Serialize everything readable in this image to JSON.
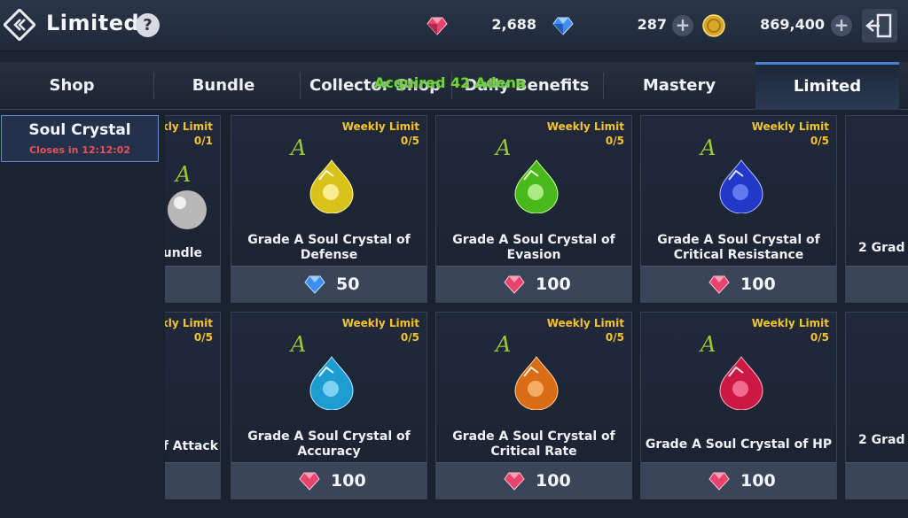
{
  "header": {
    "title": "Limited",
    "help_label": "?",
    "currencies": [
      {
        "icon": "red-gem-icon",
        "value": "2,688"
      },
      {
        "icon": "blue-diamond-icon",
        "value": "287"
      },
      {
        "icon": "gold-coin-icon",
        "value": "869,400"
      }
    ]
  },
  "tabs": [
    {
      "label": "Shop",
      "active": false
    },
    {
      "label": "Bundle",
      "active": false
    },
    {
      "label": "Collector Shop",
      "active": false
    },
    {
      "label": "Daily Benefits",
      "active": false
    },
    {
      "label": "Mastery",
      "active": false
    },
    {
      "label": "Limited",
      "active": true
    }
  ],
  "toast": "Acquired 42 Adena",
  "sidebar": {
    "items": [
      {
        "label": "Soul Crystal",
        "sub": "Closes in 12:12:02"
      }
    ]
  },
  "colors": {
    "accent": "#5d8cd6",
    "limit_text": "#f4c430",
    "timer_text": "#e8505b",
    "toast_text": "#6fd33b"
  },
  "cards": [
    {
      "limit_label": "Weekly Limit",
      "limit_count": "0/1",
      "name": "Bundle",
      "grade": "A",
      "gem_color": "#c8c8c8",
      "price_icon": "",
      "price": ""
    },
    {
      "limit_label": "Weekly Limit",
      "limit_count": "0/5",
      "name": "Grade A Soul Crystal of Defense",
      "grade": "A",
      "gem_color": "#e2cf1c",
      "price_icon": "blue-diamond-icon",
      "price": "50"
    },
    {
      "limit_label": "Weekly Limit",
      "limit_count": "0/5",
      "name": "Grade A Soul Crystal of Evasion",
      "grade": "A",
      "gem_color": "#4fc31a",
      "price_icon": "red-gem-icon",
      "price": "100"
    },
    {
      "limit_label": "Weekly Limit",
      "limit_count": "0/5",
      "name": "Grade A Soul Crystal of Critical Resistance",
      "grade": "A",
      "gem_color": "#2741d6",
      "price_icon": "red-gem-icon",
      "price": "100"
    },
    {
      "limit_label": "",
      "limit_count": "",
      "name": "2 Grad",
      "grade": "",
      "gem_color": "",
      "price_icon": "",
      "price": ""
    },
    {
      "limit_label": "Weekly Limit",
      "limit_count": "0/5",
      "name": "of Attack",
      "grade": "",
      "gem_color": "",
      "price_icon": "",
      "price": ""
    },
    {
      "limit_label": "Weekly Limit",
      "limit_count": "0/5",
      "name": "Grade A Soul Crystal of Accuracy",
      "grade": "A",
      "gem_color": "#1fa6d6",
      "price_icon": "red-gem-icon",
      "price": "100"
    },
    {
      "limit_label": "Weekly Limit",
      "limit_count": "0/5",
      "name": "Grade A Soul Crystal of Critical Rate",
      "grade": "A",
      "gem_color": "#e0761a",
      "price_icon": "red-gem-icon",
      "price": "100"
    },
    {
      "limit_label": "Weekly Limit",
      "limit_count": "0/5",
      "name": "Grade A Soul Crystal of HP",
      "grade": "A",
      "gem_color": "#d41c4a",
      "price_icon": "red-gem-icon",
      "price": "100"
    },
    {
      "limit_label": "",
      "limit_count": "",
      "name": "2 Grad",
      "grade": "",
      "gem_color": "",
      "price_icon": "",
      "price": ""
    }
  ]
}
